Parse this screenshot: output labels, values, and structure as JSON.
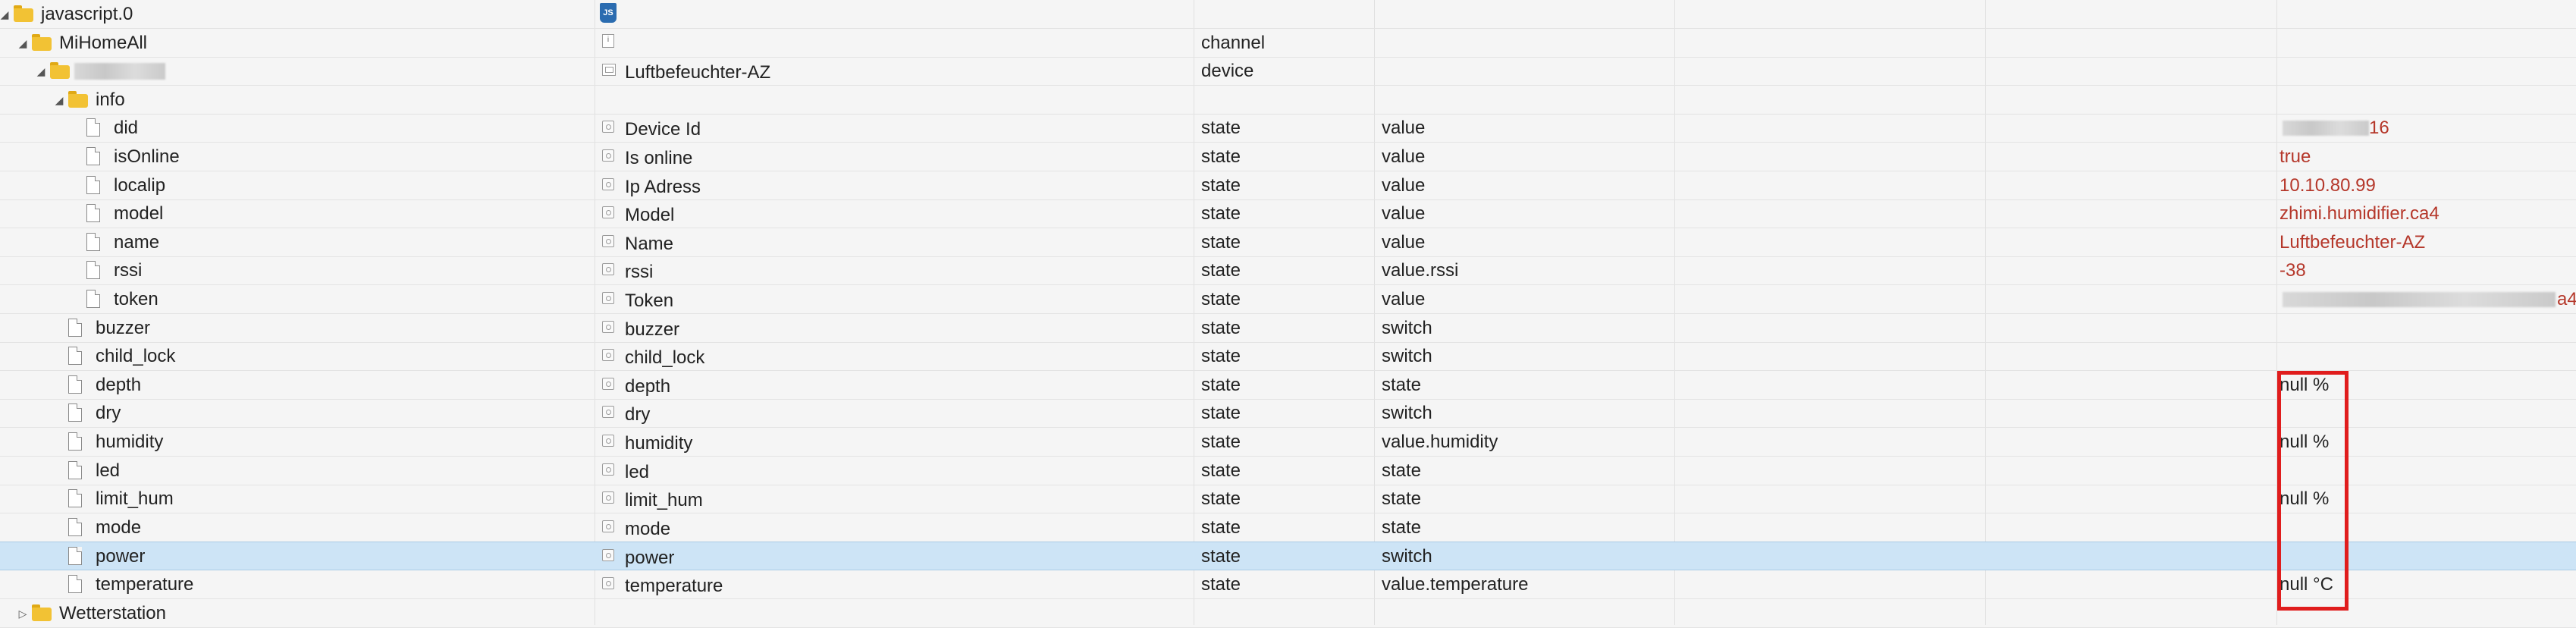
{
  "rows": [
    {
      "depth": 0,
      "kind": "folder",
      "toggle": "expanded",
      "label": "javascript.0",
      "name": "",
      "name_icon": "js-icon",
      "type": "",
      "role": "",
      "value": ""
    },
    {
      "depth": 1,
      "kind": "folder",
      "toggle": "expanded",
      "label": "MiHomeAll",
      "name": "",
      "name_icon": "channel-icon",
      "type": "channel",
      "role": "",
      "value": ""
    },
    {
      "depth": 2,
      "kind": "folder",
      "toggle": "expanded",
      "label": "",
      "label_redacted": true,
      "name": "Luftbefeuchter-AZ",
      "name_icon": "device-icon",
      "type": "device",
      "role": "",
      "value": ""
    },
    {
      "depth": 3,
      "kind": "folder",
      "toggle": "expanded",
      "label": "info",
      "name": "",
      "name_icon": "",
      "type": "",
      "role": "",
      "value": ""
    },
    {
      "depth": 4,
      "kind": "file",
      "label": "did",
      "name": "Device Id",
      "name_icon": "state-icon",
      "type": "state",
      "role": "value",
      "value": "16",
      "value_redacted": true
    },
    {
      "depth": 4,
      "kind": "file",
      "label": "isOnline",
      "name": "Is online",
      "name_icon": "state-icon",
      "type": "state",
      "role": "value",
      "value": "true"
    },
    {
      "depth": 4,
      "kind": "file",
      "label": "localip",
      "name": "Ip Adress",
      "name_icon": "state-icon",
      "type": "state",
      "role": "value",
      "value": "10.10.80.99"
    },
    {
      "depth": 4,
      "kind": "file",
      "label": "model",
      "name": "Model",
      "name_icon": "state-icon",
      "type": "state",
      "role": "value",
      "value": "zhimi.humidifier.ca4"
    },
    {
      "depth": 4,
      "kind": "file",
      "label": "name",
      "name": "Name",
      "name_icon": "state-icon",
      "type": "state",
      "role": "value",
      "value": "Luftbefeuchter-AZ"
    },
    {
      "depth": 4,
      "kind": "file",
      "label": "rssi",
      "name": "rssi",
      "name_icon": "state-icon",
      "type": "state",
      "role": "value.rssi",
      "value": "-38"
    },
    {
      "depth": 4,
      "kind": "file",
      "label": "token",
      "name": "Token",
      "name_icon": "state-icon",
      "type": "state",
      "role": "value",
      "value": "a4",
      "value_redacted": true
    },
    {
      "depth": 3,
      "kind": "file",
      "label": "buzzer",
      "name": "buzzer",
      "name_icon": "state-icon",
      "type": "state",
      "role": "switch",
      "value": ""
    },
    {
      "depth": 3,
      "kind": "file",
      "label": "child_lock",
      "name": "child_lock",
      "name_icon": "state-icon",
      "type": "state",
      "role": "switch",
      "value": ""
    },
    {
      "depth": 3,
      "kind": "file",
      "label": "depth",
      "name": "depth",
      "name_icon": "state-icon",
      "type": "state",
      "role": "state",
      "value": "null %",
      "value_black": true
    },
    {
      "depth": 3,
      "kind": "file",
      "label": "dry",
      "name": "dry",
      "name_icon": "state-icon",
      "type": "state",
      "role": "switch",
      "value": ""
    },
    {
      "depth": 3,
      "kind": "file",
      "label": "humidity",
      "name": "humidity",
      "name_icon": "state-icon",
      "type": "state",
      "role": "value.humidity",
      "value": "null %",
      "value_black": true
    },
    {
      "depth": 3,
      "kind": "file",
      "label": "led",
      "name": "led",
      "name_icon": "state-icon",
      "type": "state",
      "role": "state",
      "value": ""
    },
    {
      "depth": 3,
      "kind": "file",
      "label": "limit_hum",
      "name": "limit_hum",
      "name_icon": "state-icon",
      "type": "state",
      "role": "state",
      "value": "null %",
      "value_black": true
    },
    {
      "depth": 3,
      "kind": "file",
      "label": "mode",
      "name": "mode",
      "name_icon": "state-icon",
      "type": "state",
      "role": "state",
      "value": ""
    },
    {
      "depth": 3,
      "kind": "file",
      "label": "power",
      "name": "power",
      "name_icon": "state-icon",
      "type": "state",
      "role": "switch",
      "value": "",
      "selected": true
    },
    {
      "depth": 3,
      "kind": "file",
      "label": "temperature",
      "name": "temperature",
      "name_icon": "state-icon",
      "type": "state",
      "role": "value.temperature",
      "value": "null °C",
      "value_black": true
    },
    {
      "depth": 1,
      "kind": "folder",
      "toggle": "collapsed",
      "label": "Wetterstation",
      "name": "",
      "name_icon": "",
      "type": "",
      "role": "",
      "value": ""
    }
  ],
  "colors": {
    "value_text": "#b5372a",
    "highlight_box": "#e01d1d",
    "selected_row": "#cde4f6"
  }
}
